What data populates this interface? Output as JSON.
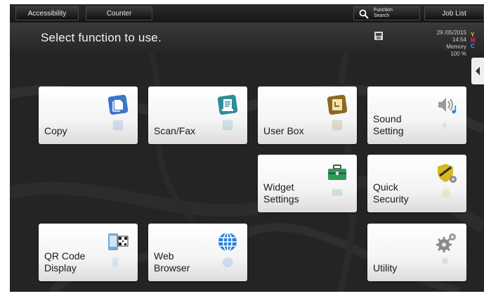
{
  "topbar": {
    "accessibility": "Accessibility",
    "counter": "Counter",
    "function_search_line1": "Function",
    "function_search_line2": "Search",
    "job_list": "Job List"
  },
  "header": {
    "title": "Select function to use.",
    "date": "29 /05/2015",
    "time": "14:54",
    "memory_label": "Memory",
    "memory_value": "100 %",
    "toner": [
      "Y",
      "M",
      "C"
    ]
  },
  "tiles": {
    "copy": "Copy",
    "scan_fax": "Scan/Fax",
    "user_box": "User Box",
    "sound_setting_line1": "Sound",
    "sound_setting_line2": "Setting",
    "widget_settings_line1": "Widget",
    "widget_settings_line2": "Settings",
    "quick_security_line1": "Quick",
    "quick_security_line2": "Security",
    "qr_code_line1": "QR Code",
    "qr_code_line2": "Display",
    "web_browser_line1": "Web",
    "web_browser_line2": "Browser",
    "utility": "Utility"
  },
  "colors": {
    "copy_icon": "#3a78c8",
    "scan_icon": "#2e8e9a",
    "user_box_icon": "#8a6a20",
    "toolbox_icon": "#2e9a5a",
    "shield_icon": "#d4b820",
    "globe_icon": "#2a82d8",
    "toner_y": "#e8d000",
    "toner_m": "#d8208a",
    "toner_c": "#20a8e0"
  }
}
